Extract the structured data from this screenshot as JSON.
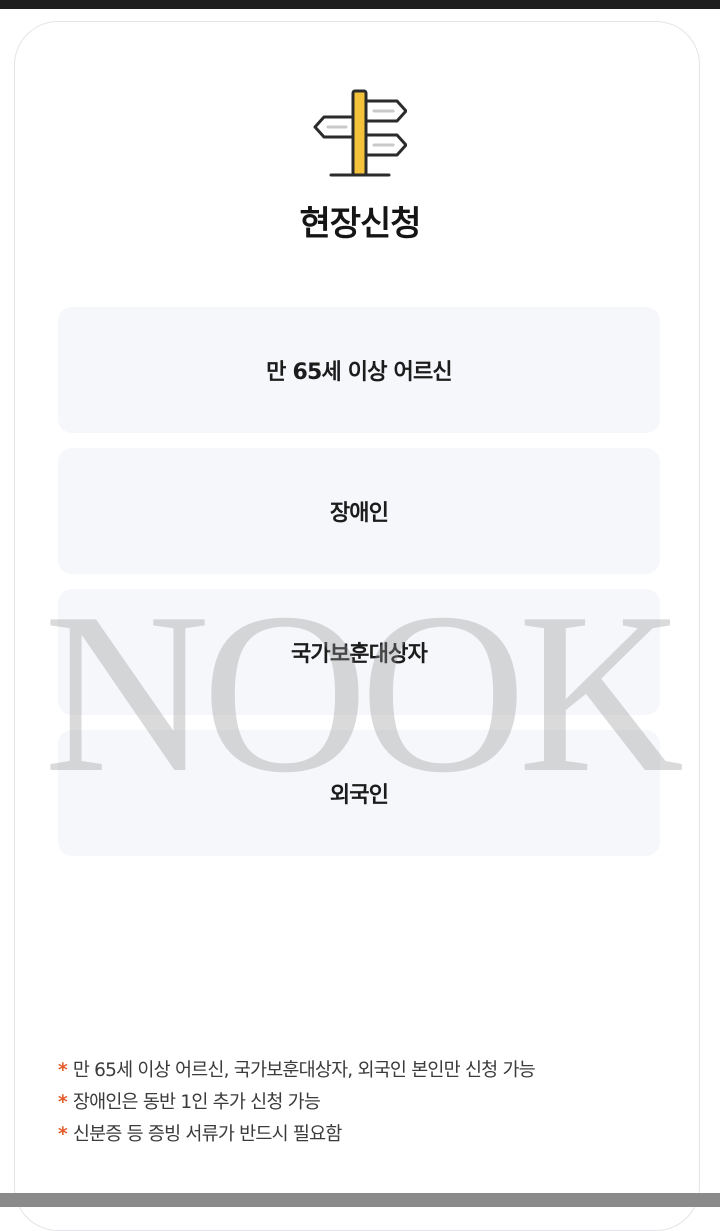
{
  "title": "현장신청",
  "icon": "signpost-icon",
  "options": [
    {
      "label": "만 65세 이상 어르신"
    },
    {
      "label": "장애인"
    },
    {
      "label": "국가보훈대상자"
    },
    {
      "label": "외국인"
    }
  ],
  "watermark": "NOOK",
  "notes": {
    "marker": "*",
    "items": [
      "만 65세 이상 어르신, 국가보훈대상자, 외국인 본인만 신청 가능",
      "장애인은 동반 1인 추가 신청 가능",
      "신분증 등 증빙 서류가 반드시 필요함"
    ]
  },
  "colors": {
    "accent_icon": "#f5c33b",
    "note_marker": "#e35a2a",
    "option_background": "#f6f7fb"
  }
}
